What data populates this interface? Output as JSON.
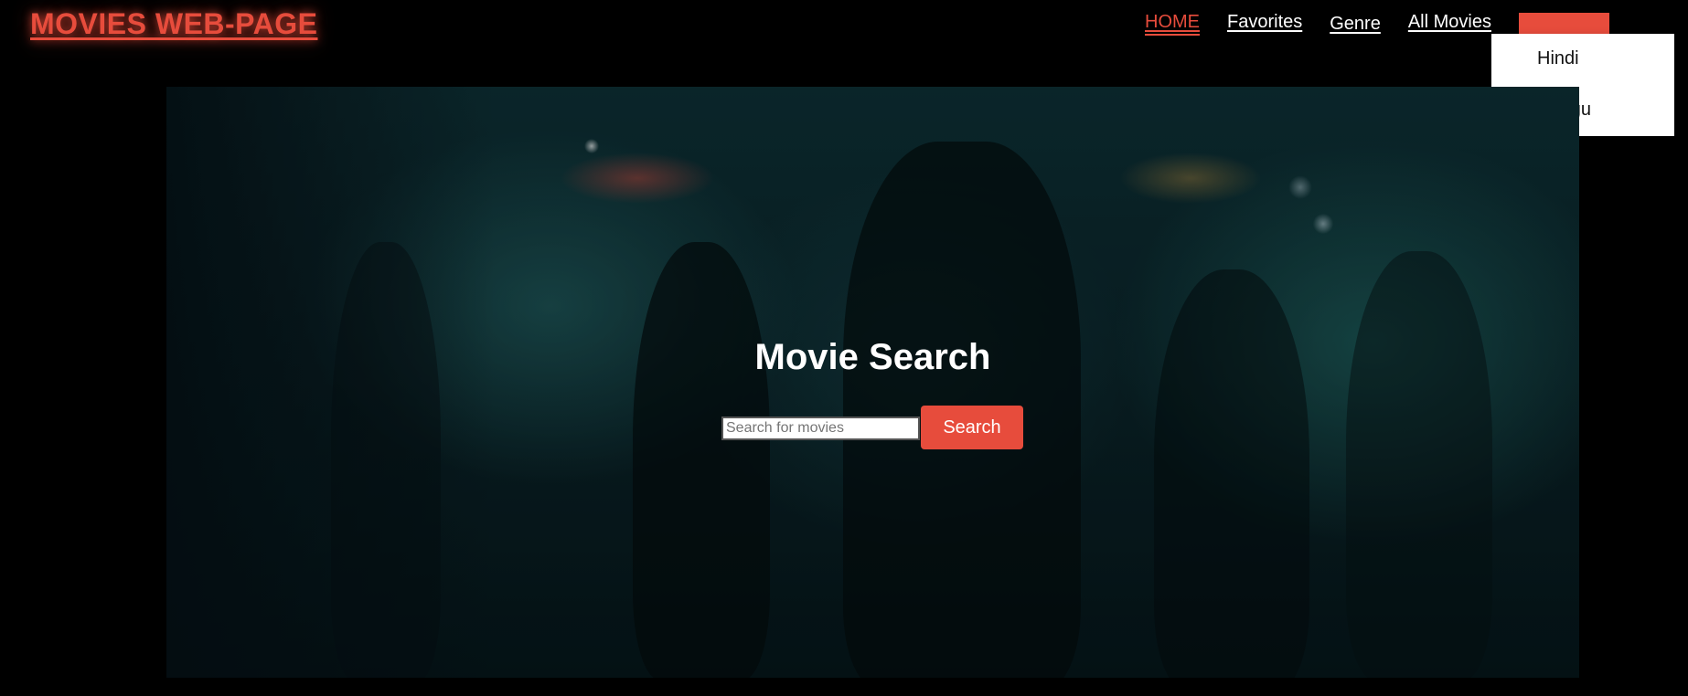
{
  "header": {
    "brand": "MOVIES WEB-PAGE",
    "nav": [
      {
        "label": "HOME",
        "active": true
      },
      {
        "label": "Favorites",
        "active": false
      },
      {
        "label": "Genre",
        "active": false
      },
      {
        "label": "All Movies",
        "active": false
      }
    ],
    "language_dropdown": {
      "label": "",
      "options": [
        "Hindi",
        "Telugu"
      ]
    }
  },
  "hero": {
    "title": "Movie Search",
    "search": {
      "value": "",
      "placeholder": "Search for movies",
      "button_label": "Search"
    }
  },
  "colors": {
    "accent": "#e74c3c",
    "background": "#000000",
    "text": "#ffffff"
  }
}
